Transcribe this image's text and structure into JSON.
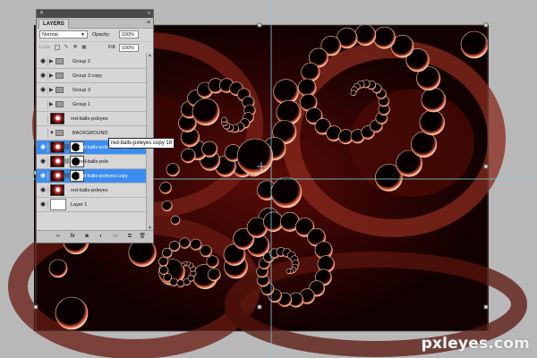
{
  "layers_panel": {
    "tab_label": "LAYERS",
    "blend_mode": "Normal",
    "opacity_label": "Opacity:",
    "opacity_value": "100%",
    "lock_label": "Lock:",
    "fill_label": "Fill:",
    "fill_value": "100%",
    "layers": [
      {
        "name": "Group 2",
        "kind": "group",
        "visible": true,
        "selected": false
      },
      {
        "name": "Group 3 copy",
        "kind": "group",
        "visible": true,
        "selected": false
      },
      {
        "name": "Group 3",
        "kind": "group",
        "visible": true,
        "selected": false
      },
      {
        "name": "Group 1",
        "kind": "group",
        "visible": false,
        "selected": false
      },
      {
        "name": "red-balls-pxleyes",
        "kind": "pixel",
        "visible": false,
        "selected": false
      },
      {
        "name": "BACKGROUND",
        "kind": "group-open",
        "visible": false,
        "selected": false
      },
      {
        "name": "red-balls-pxleyes copy ...",
        "kind": "masked",
        "visible": true,
        "selected": true
      },
      {
        "name": "red-balls-pxle",
        "kind": "masked",
        "visible": true,
        "selected": false
      },
      {
        "name": "red-balls-pxleyes copy",
        "kind": "masked",
        "visible": true,
        "selected": true
      },
      {
        "name": "red-balls-pxleyes",
        "kind": "pixel",
        "visible": true,
        "selected": false
      },
      {
        "name": "Layer 1",
        "kind": "white",
        "visible": true,
        "selected": false
      }
    ],
    "tooltip": "red-balls-pxleyes copy 18"
  },
  "icons": {
    "eye": "eye-icon",
    "folder": "folder-icon",
    "link": "link-icon",
    "fx": "fx-icon",
    "mask": "add-mask-icon",
    "adjustment": "adjustment-layer-icon",
    "new_group": "new-group-icon",
    "new_layer": "new-layer-icon",
    "trash": "trash-icon"
  },
  "colors": {
    "selection": "#3c8df2",
    "guide": "#7fd3e0",
    "art_dark": "#1a0202",
    "art_red": "#c0301c"
  },
  "watermark": "pxleyes.com"
}
